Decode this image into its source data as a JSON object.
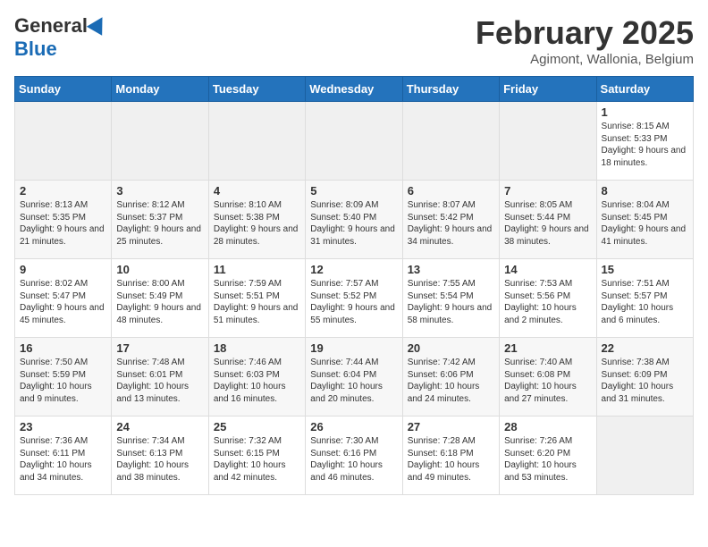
{
  "header": {
    "logo_general": "General",
    "logo_blue": "Blue",
    "month_title": "February 2025",
    "location": "Agimont, Wallonia, Belgium"
  },
  "weekdays": [
    "Sunday",
    "Monday",
    "Tuesday",
    "Wednesday",
    "Thursday",
    "Friday",
    "Saturday"
  ],
  "weeks": [
    [
      {
        "day": "",
        "info": ""
      },
      {
        "day": "",
        "info": ""
      },
      {
        "day": "",
        "info": ""
      },
      {
        "day": "",
        "info": ""
      },
      {
        "day": "",
        "info": ""
      },
      {
        "day": "",
        "info": ""
      },
      {
        "day": "1",
        "info": "Sunrise: 8:15 AM\nSunset: 5:33 PM\nDaylight: 9 hours and 18 minutes."
      }
    ],
    [
      {
        "day": "2",
        "info": "Sunrise: 8:13 AM\nSunset: 5:35 PM\nDaylight: 9 hours and 21 minutes."
      },
      {
        "day": "3",
        "info": "Sunrise: 8:12 AM\nSunset: 5:37 PM\nDaylight: 9 hours and 25 minutes."
      },
      {
        "day": "4",
        "info": "Sunrise: 8:10 AM\nSunset: 5:38 PM\nDaylight: 9 hours and 28 minutes."
      },
      {
        "day": "5",
        "info": "Sunrise: 8:09 AM\nSunset: 5:40 PM\nDaylight: 9 hours and 31 minutes."
      },
      {
        "day": "6",
        "info": "Sunrise: 8:07 AM\nSunset: 5:42 PM\nDaylight: 9 hours and 34 minutes."
      },
      {
        "day": "7",
        "info": "Sunrise: 8:05 AM\nSunset: 5:44 PM\nDaylight: 9 hours and 38 minutes."
      },
      {
        "day": "8",
        "info": "Sunrise: 8:04 AM\nSunset: 5:45 PM\nDaylight: 9 hours and 41 minutes."
      }
    ],
    [
      {
        "day": "9",
        "info": "Sunrise: 8:02 AM\nSunset: 5:47 PM\nDaylight: 9 hours and 45 minutes."
      },
      {
        "day": "10",
        "info": "Sunrise: 8:00 AM\nSunset: 5:49 PM\nDaylight: 9 hours and 48 minutes."
      },
      {
        "day": "11",
        "info": "Sunrise: 7:59 AM\nSunset: 5:51 PM\nDaylight: 9 hours and 51 minutes."
      },
      {
        "day": "12",
        "info": "Sunrise: 7:57 AM\nSunset: 5:52 PM\nDaylight: 9 hours and 55 minutes."
      },
      {
        "day": "13",
        "info": "Sunrise: 7:55 AM\nSunset: 5:54 PM\nDaylight: 9 hours and 58 minutes."
      },
      {
        "day": "14",
        "info": "Sunrise: 7:53 AM\nSunset: 5:56 PM\nDaylight: 10 hours and 2 minutes."
      },
      {
        "day": "15",
        "info": "Sunrise: 7:51 AM\nSunset: 5:57 PM\nDaylight: 10 hours and 6 minutes."
      }
    ],
    [
      {
        "day": "16",
        "info": "Sunrise: 7:50 AM\nSunset: 5:59 PM\nDaylight: 10 hours and 9 minutes."
      },
      {
        "day": "17",
        "info": "Sunrise: 7:48 AM\nSunset: 6:01 PM\nDaylight: 10 hours and 13 minutes."
      },
      {
        "day": "18",
        "info": "Sunrise: 7:46 AM\nSunset: 6:03 PM\nDaylight: 10 hours and 16 minutes."
      },
      {
        "day": "19",
        "info": "Sunrise: 7:44 AM\nSunset: 6:04 PM\nDaylight: 10 hours and 20 minutes."
      },
      {
        "day": "20",
        "info": "Sunrise: 7:42 AM\nSunset: 6:06 PM\nDaylight: 10 hours and 24 minutes."
      },
      {
        "day": "21",
        "info": "Sunrise: 7:40 AM\nSunset: 6:08 PM\nDaylight: 10 hours and 27 minutes."
      },
      {
        "day": "22",
        "info": "Sunrise: 7:38 AM\nSunset: 6:09 PM\nDaylight: 10 hours and 31 minutes."
      }
    ],
    [
      {
        "day": "23",
        "info": "Sunrise: 7:36 AM\nSunset: 6:11 PM\nDaylight: 10 hours and 34 minutes."
      },
      {
        "day": "24",
        "info": "Sunrise: 7:34 AM\nSunset: 6:13 PM\nDaylight: 10 hours and 38 minutes."
      },
      {
        "day": "25",
        "info": "Sunrise: 7:32 AM\nSunset: 6:15 PM\nDaylight: 10 hours and 42 minutes."
      },
      {
        "day": "26",
        "info": "Sunrise: 7:30 AM\nSunset: 6:16 PM\nDaylight: 10 hours and 46 minutes."
      },
      {
        "day": "27",
        "info": "Sunrise: 7:28 AM\nSunset: 6:18 PM\nDaylight: 10 hours and 49 minutes."
      },
      {
        "day": "28",
        "info": "Sunrise: 7:26 AM\nSunset: 6:20 PM\nDaylight: 10 hours and 53 minutes."
      },
      {
        "day": "",
        "info": ""
      }
    ]
  ]
}
